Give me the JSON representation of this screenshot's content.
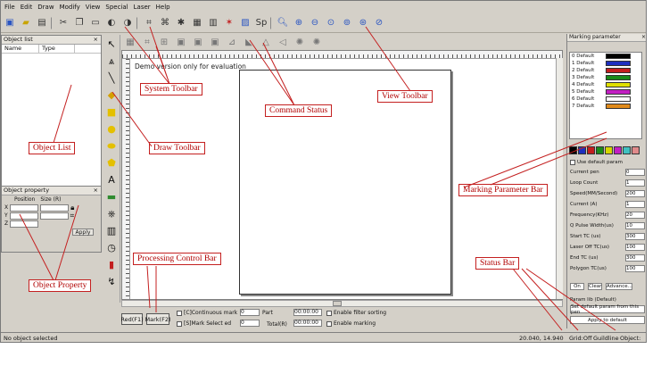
{
  "menu": [
    "File",
    "Edit",
    "Draw",
    "Modify",
    "View",
    "Special",
    "Laser",
    "Help"
  ],
  "object_list": {
    "title": "Object list",
    "columns": [
      "Name",
      "Type"
    ]
  },
  "object_property": {
    "title": "Object property",
    "headers": [
      "Position",
      "Size (R)"
    ],
    "rows": [
      "X",
      "Y",
      "Z"
    ],
    "apply_label": "Apply"
  },
  "canvas": {
    "demo_text": "Demo version only for evaluation"
  },
  "processing": {
    "red_button": "Red(F1)",
    "mark_button": "Mark(F2)",
    "checks": [
      "[C]Continuous mark",
      "[S]Mark Select ed",
      "Part",
      "Total(R)"
    ],
    "values": [
      "0",
      "0"
    ],
    "times": [
      "00:00:00",
      "00:00:00"
    ],
    "count_checks": [
      "Enable filter sorting",
      "Enable marking"
    ]
  },
  "mark_panel": {
    "title": "Marking parameter",
    "pens": [
      {
        "name": "0 Default",
        "color": "#000000"
      },
      {
        "name": "1 Default",
        "color": "#1e2fbf"
      },
      {
        "name": "2 Default",
        "color": "#c41e1e"
      },
      {
        "name": "3 Default",
        "color": "#1a8a1a"
      },
      {
        "name": "4 Default",
        "color": "#e0e000"
      },
      {
        "name": "5 Default",
        "color": "#c21fc2"
      },
      {
        "name": "6 Default",
        "color": "#ffffff"
      },
      {
        "name": "7 Default",
        "color": "#e08a1a"
      }
    ],
    "palette": [
      "#000000",
      "#1e2fbf",
      "#c41e1e",
      "#1a8a1a",
      "#d6d600",
      "#c21fc2",
      "#40c0c0",
      "#e08a8a"
    ],
    "use_default": "Use default param",
    "params": [
      {
        "label": "Current pen",
        "value": "0"
      },
      {
        "label": "Loop Count",
        "value": "1"
      },
      {
        "label": "Speed(MM/Second)",
        "value": "200"
      },
      {
        "label": "Current (A)",
        "value": "1"
      },
      {
        "label": "Frequency(KHz)",
        "value": "20"
      },
      {
        "label": "Q Pulse Width(us)",
        "value": "10"
      },
      {
        "label": "Start TC (us)",
        "value": "300"
      },
      {
        "label": "Laser Off TC(us)",
        "value": "100"
      },
      {
        "label": "End TC (us)",
        "value": "300"
      },
      {
        "label": "Polygon TC(us)",
        "value": "100"
      }
    ],
    "bottom_labels": [
      "Param lib (Default)",
      "Set default param from this pen",
      "Apply to default"
    ],
    "option_buttons": [
      "On",
      "Clear",
      "Advance..."
    ]
  },
  "status": {
    "left": "No object selected",
    "coords": "20.040, 14.940",
    "snap": "Grid:Off",
    "guide": "Guildline",
    "object": "Object:"
  },
  "annotations": {
    "system_toolbar": "System Toolbar",
    "command_status": "Command Status",
    "view_toolbar": "View Toolbar",
    "object_list": "Object List",
    "draw_toolbar": "Draw Toolbar",
    "marking_parameter_bar": "Marking Parameter Bar",
    "processing_control_bar": "Processing Control Bar",
    "status_bar": "Status Bar",
    "object_property": "Object Property"
  },
  "annotation_color": "#c42020"
}
